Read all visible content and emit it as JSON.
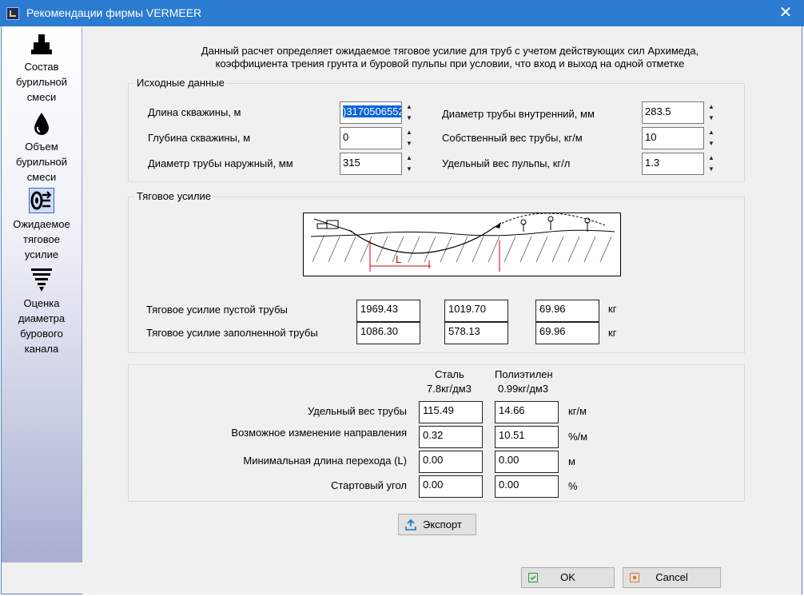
{
  "window": {
    "title": "Рекомендации фирмы VERMEER",
    "close_glyph": "✕"
  },
  "sidebar": {
    "items": [
      {
        "label": "Состав\nбурильной\nсмеси",
        "icon": "mixer-icon"
      },
      {
        "label": "Объем\nбурильной\nсмеси",
        "icon": "drop-icon"
      },
      {
        "label": "Ожидаемое\nтяговое\nусилие",
        "icon": "pull-force-icon"
      },
      {
        "label": "Оценка\nдиаметра\nбурового\nканала",
        "icon": "funnel-icon"
      }
    ]
  },
  "description": "Данный расчет определяет ожидаемое тяговое усилие для труб с учетом действующих сил Архимеда,\nкоэффициента трения грунта и буровой пульпы при условии, что вход и выход на одной отметке",
  "input_group": {
    "title": "Исходные данные",
    "fields": [
      {
        "label": "Длина скважины, м",
        "value": ")3170506552"
      },
      {
        "label": "Глубина скважины, м",
        "value": "0"
      },
      {
        "label": "Диаметр трубы наружный, мм",
        "value": "315"
      },
      {
        "label": "Диаметр трубы внутренний, мм",
        "value": "283.5"
      },
      {
        "label": "Собственный вес трубы, кг/м",
        "value": "10"
      },
      {
        "label": "Удельный вес пульпы, кг/л",
        "value": "1.3"
      }
    ]
  },
  "traction_group": {
    "title": "Тяговое усилие",
    "diagram_label": "L",
    "rows": [
      {
        "label": "Тяговое усилие пустой трубы",
        "values": [
          "1969.43",
          "1019.70",
          "69.96"
        ],
        "unit": "кг"
      },
      {
        "label": "Тяговое усилие заполненной трубы",
        "values": [
          "1086.30",
          "578.13",
          "69.96"
        ],
        "unit": "кг"
      }
    ]
  },
  "material_group": {
    "columns": [
      {
        "name": "Сталь",
        "density": "7.8кг/дм3"
      },
      {
        "name": "Полиэтилен",
        "density": "0.99кг/дм3"
      }
    ],
    "rows": [
      {
        "label": "Удельный вес трубы",
        "values": [
          "115.49",
          "14.66"
        ],
        "unit": "кг/м"
      },
      {
        "label": "Возможное изменение направления",
        "values": [
          "0.32",
          "10.51"
        ],
        "unit": "%/м"
      },
      {
        "label": "Минимальная длина перехода (L)",
        "values": [
          "0.00",
          "0.00"
        ],
        "unit": "м"
      },
      {
        "label": "Стартовый угол",
        "values": [
          "0.00",
          "0.00"
        ],
        "unit": "%"
      }
    ]
  },
  "export_button": {
    "label": "Экспорт"
  },
  "footer": {
    "ok_label": "OK",
    "cancel_label": "Cancel"
  },
  "colors": {
    "titlebar": "#2b7bd0",
    "selection": "#0a64d8",
    "diagram_red": "#d40000"
  }
}
